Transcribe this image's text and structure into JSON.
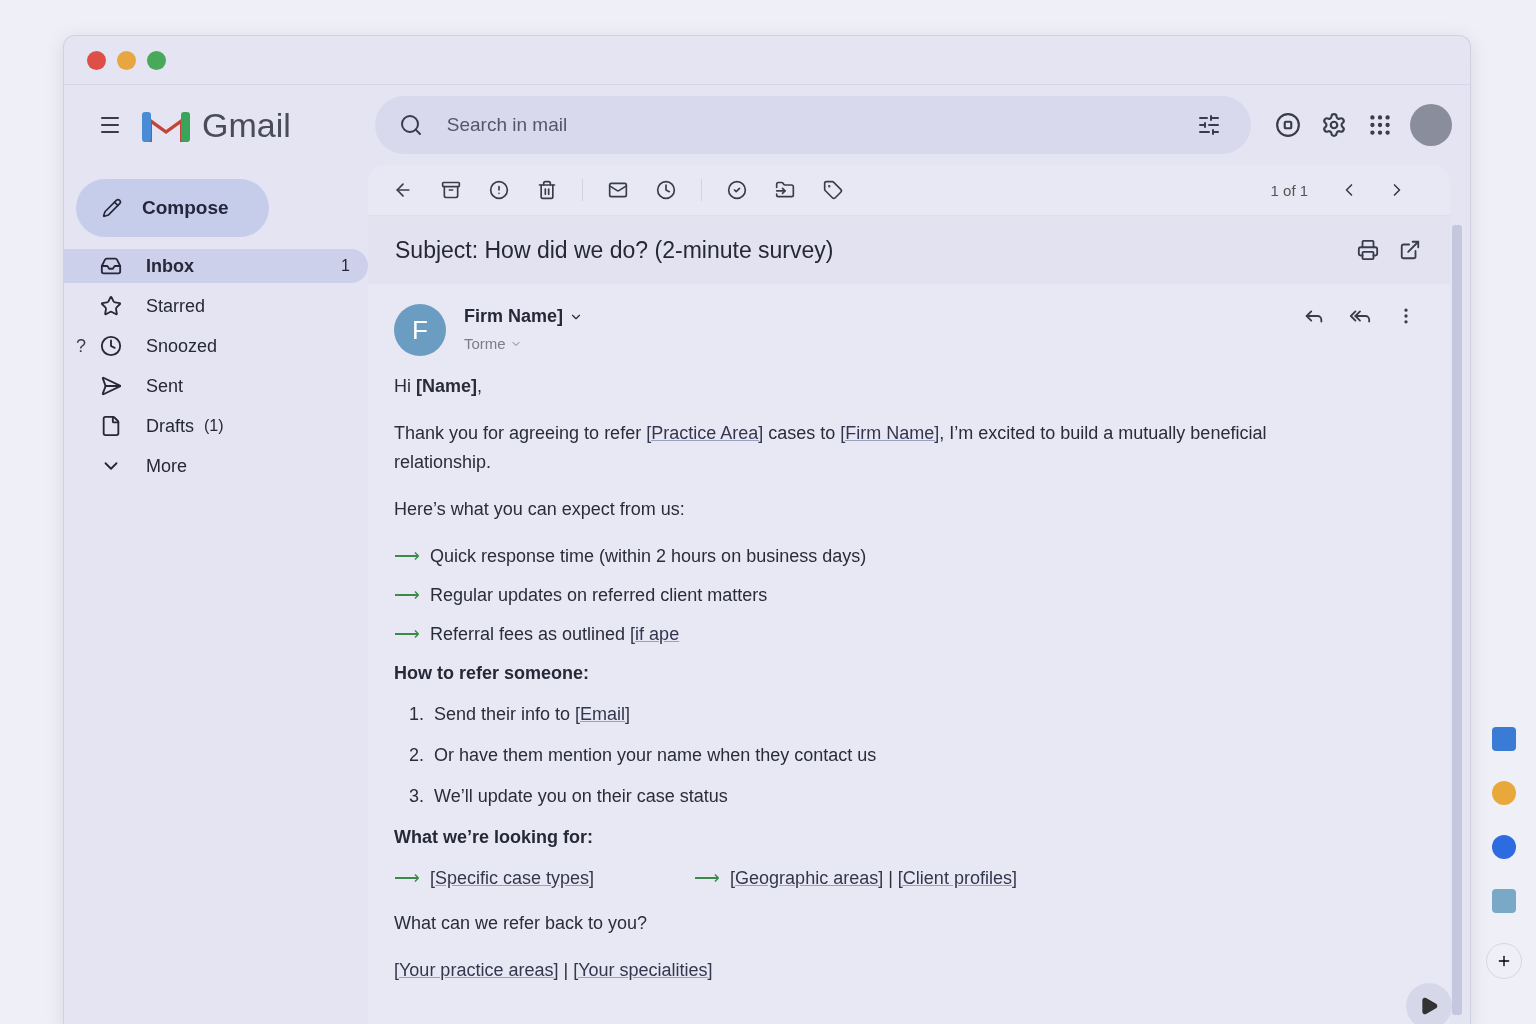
{
  "window": {
    "controls": [
      {
        "color": "#dd5048"
      },
      {
        "color": "#e8a640"
      },
      {
        "color": "#4aa85a"
      }
    ]
  },
  "header": {
    "logo_text": "Gmail",
    "search": {
      "placeholder": "Search in mail"
    }
  },
  "compose": {
    "label": "Compose"
  },
  "sidebar": {
    "items": [
      {
        "kind": "inbox",
        "label": "Inbox",
        "count": "1",
        "selected": true
      },
      {
        "kind": "starred",
        "label": "Starred",
        "selected": false
      },
      {
        "kind": "snoozed",
        "label": "Snoozed",
        "prefix": "?",
        "selected": false
      },
      {
        "kind": "sent",
        "label": "Sent",
        "selected": false
      },
      {
        "kind": "drafts",
        "label": "Drafts",
        "count": "(1)",
        "selected": false
      },
      {
        "kind": "more",
        "label": "More",
        "selected": false
      }
    ]
  },
  "toolbar": {
    "pager": "1 of 1"
  },
  "message": {
    "subject": "Subject: How did we do? (2-minute survey)",
    "sender": {
      "initial": "F",
      "name": "Firm Name]",
      "to": "Torme"
    },
    "body": [
      {
        "kind": "paragraph",
        "parts": [
          {
            "text": "Hi **[Name]**,",
            "link": false
          }
        ]
      },
      {
        "kind": "paragraph",
        "parts": [
          {
            "text": "Thank you for agreeing to refer ",
            "link": false
          },
          {
            "text": "[Practice Area]",
            "link": true
          },
          {
            "text": " cases to ",
            "link": false
          },
          {
            "text": "[Firm Name]",
            "link": true
          },
          {
            "text": ", I’m excited to build a mutually beneficial relationship.",
            "link": false
          }
        ]
      },
      {
        "kind": "paragraph",
        "parts": [
          {
            "text": "Here’s what you can expect from us:",
            "link": false
          }
        ]
      },
      {
        "kind": "bullet",
        "marker": "⟶",
        "parts": [
          {
            "text": "Quick response time (within 2 hours on business days)",
            "link": false
          }
        ]
      },
      {
        "kind": "bullet",
        "marker": "⟶",
        "parts": [
          {
            "text": "Regular updates on referred client matters",
            "link": false
          }
        ]
      },
      {
        "kind": "bullet",
        "marker": "⟶",
        "parts": [
          {
            "text": "Referral fees as outlined ",
            "link": false
          },
          {
            "text": "[if ape",
            "link": true
          }
        ]
      },
      {
        "kind": "heading",
        "text": "How to refer someone:"
      },
      {
        "kind": "numbered",
        "number": "1.",
        "parts": [
          {
            "text": "Send their info to ",
            "link": false
          },
          {
            "text": "[Email]",
            "link": true
          }
        ]
      },
      {
        "kind": "numbered",
        "number": "2.",
        "parts": [
          {
            "text": "Or have them mention your name when they contact us",
            "link": false
          }
        ]
      },
      {
        "kind": "numbered",
        "number": "3.",
        "parts": [
          {
            "text": "We’ll update you on their case status",
            "link": false
          }
        ]
      },
      {
        "kind": "heading",
        "text": "What we’re looking for:"
      },
      {
        "kind": "arrow_row",
        "groups": [
          {
            "marker": "⟶",
            "parts": [
              {
                "text": "[Specific case types]",
                "link": true
              }
            ]
          },
          {
            "marker": "⟶",
            "parts": [
              {
                "text": "[Geographic areas]",
                "link": true
              },
              {
                "text": " | ",
                "link": false
              },
              {
                "text": "[Client profiles]",
                "link": true
              }
            ]
          }
        ]
      },
      {
        "kind": "paragraph",
        "parts": [
          {
            "text": "What can we refer back to you?",
            "link": false
          }
        ]
      },
      {
        "kind": "paragraph",
        "parts": [
          {
            "text": "[Your practice areas]",
            "link": true
          },
          {
            "text": " | ",
            "link": false
          },
          {
            "text": "[Your specialities]",
            "link": true
          }
        ]
      }
    ]
  }
}
